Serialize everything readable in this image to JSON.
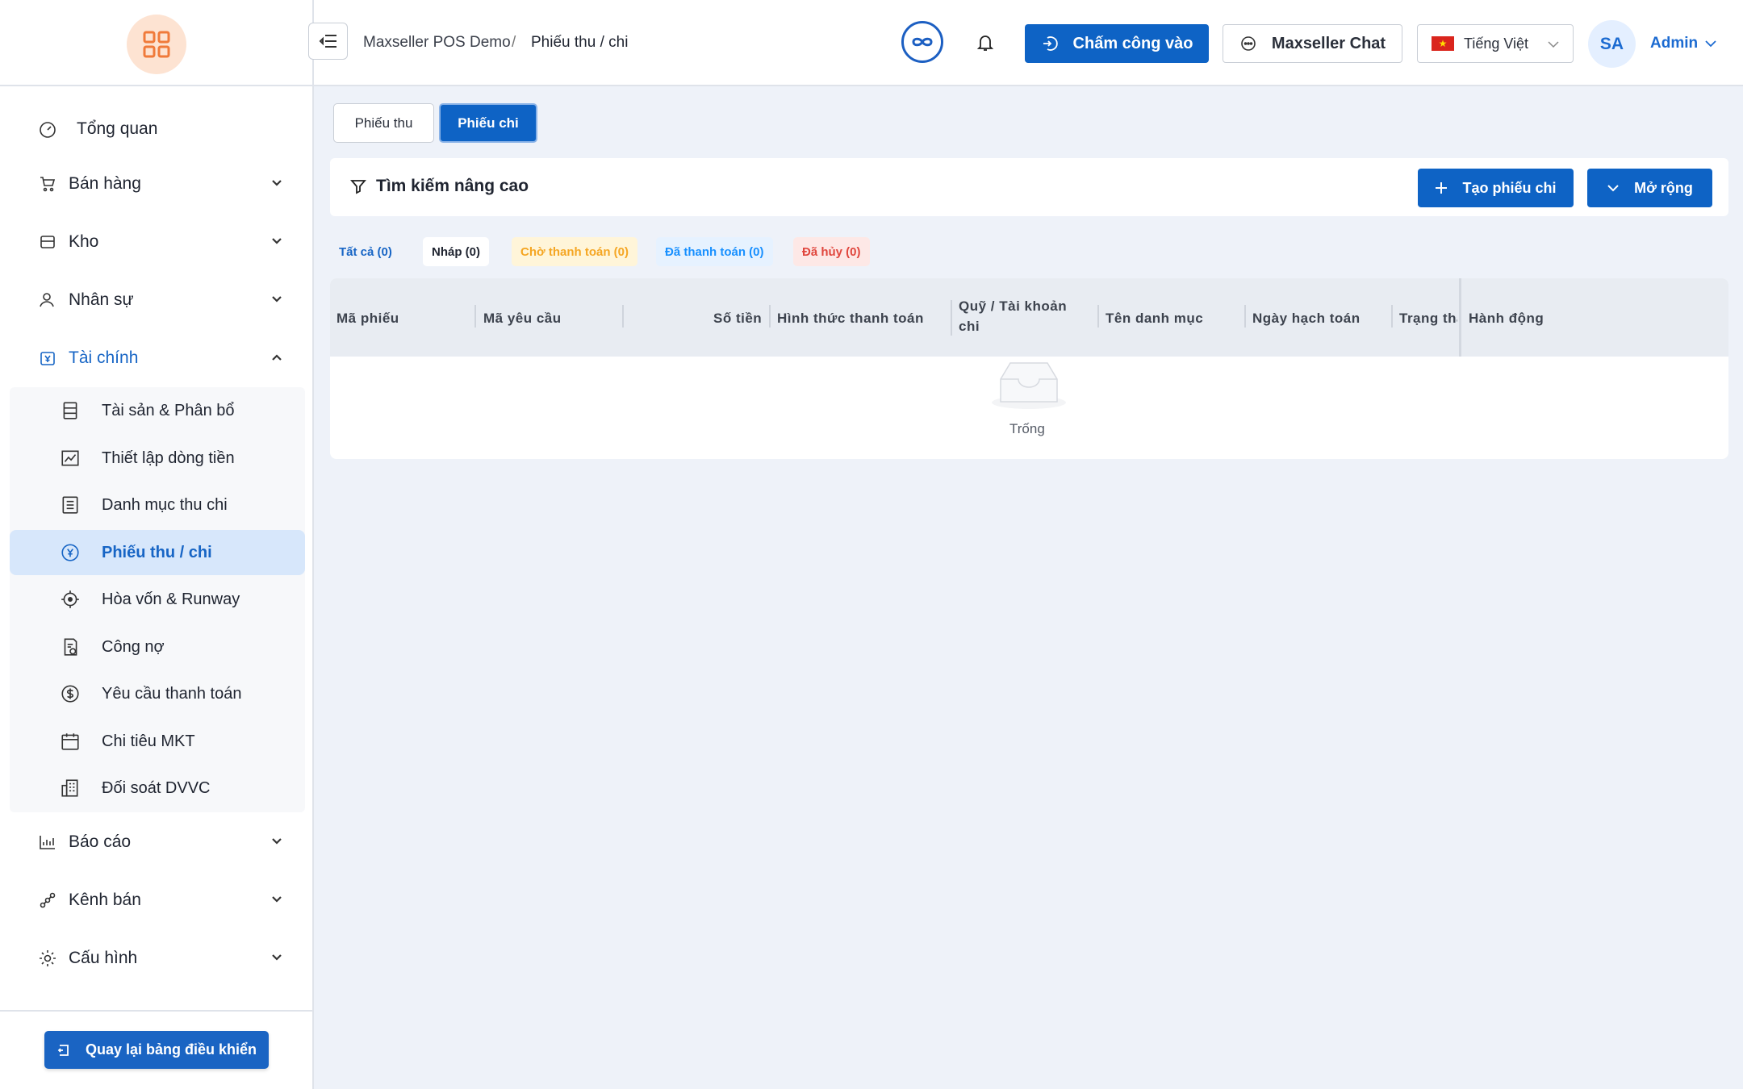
{
  "sidebar": {
    "items": [
      {
        "label": "Tổng quan"
      },
      {
        "label": "Bán hàng"
      },
      {
        "label": "Kho"
      },
      {
        "label": "Nhân sự"
      },
      {
        "label": "Tài chính"
      },
      {
        "label": "Báo cáo"
      },
      {
        "label": "Kênh bán"
      },
      {
        "label": "Cấu hình"
      }
    ],
    "finance_sub": [
      {
        "label": "Tài sản & Phân bổ"
      },
      {
        "label": "Thiết lập dòng tiền"
      },
      {
        "label": "Danh mục thu chi"
      },
      {
        "label": "Phiếu thu / chi"
      },
      {
        "label": "Hòa vốn & Runway"
      },
      {
        "label": "Công nợ"
      },
      {
        "label": "Yêu cầu thanh toán"
      },
      {
        "label": "Chi tiêu MKT"
      },
      {
        "label": "Đối soát DVVC"
      }
    ],
    "back_label": "Quay lại bảng điều khiển"
  },
  "header": {
    "breadcrumb": [
      "Maxseller POS Demo",
      "/",
      "Phiếu thu / chi"
    ],
    "checkin_label": "Chấm công vào",
    "chat_label": "Maxseller Chat",
    "language": "Tiếng Việt",
    "avatar_initials": "SA",
    "user": "Admin"
  },
  "tabs": {
    "receipt": "Phiếu thu",
    "payment": "Phiếu chi"
  },
  "filter": {
    "title": "Tìm kiếm nâng cao",
    "create_label": "Tạo phiếu chi",
    "expand_label": "Mở rộng"
  },
  "status_tabs": [
    {
      "label": "Tất cả (0)",
      "color": "#1765c5"
    },
    {
      "label": "Nháp (0)",
      "color": "#1f2430"
    },
    {
      "label": "Chờ thanh toán (0)",
      "color": "#f5a623"
    },
    {
      "label": "Đã thanh toán (0)",
      "color": "#1890ff"
    },
    {
      "label": "Đã hủy (0)",
      "color": "#e0463d"
    }
  ],
  "table": {
    "columns": [
      "Mã phiếu",
      "Mã yêu cầu",
      "Số tiền",
      "Hình thức thanh toán",
      "Quỹ / Tài khoản chi",
      "Tên danh mục",
      "Ngày hạch toán",
      "Trạng thá",
      "Hành động"
    ],
    "empty_text": "Trống"
  },
  "colors": {
    "primary": "#0e63c5",
    "accent_logo": "#f07a3a"
  }
}
